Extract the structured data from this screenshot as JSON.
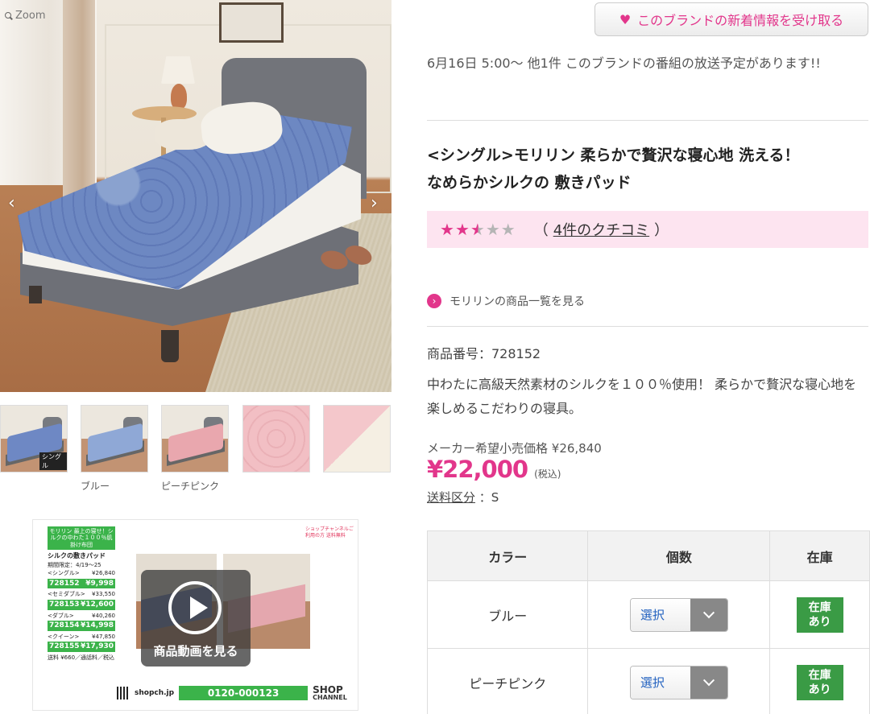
{
  "gallery": {
    "zoom_label": "Zoom",
    "prev_icon": "chevron-left-icon",
    "next_icon": "chevron-right-icon",
    "thumb_single_label": "シングル",
    "thumb_captions": [
      "ブルー",
      "ピーチピンク"
    ]
  },
  "video": {
    "banner": "モリリン 最上の寝せ！シルクの中わた１００％肌掛け布団",
    "product_name": "シルクの敷きパッド",
    "period": "期間限定：4/19〜25",
    "items": [
      {
        "size": "<シングル>",
        "msrp": "¥26,840",
        "code": "728152",
        "price": "¥9,998"
      },
      {
        "size": "<セミダブル>",
        "msrp": "¥33,550",
        "code": "728153",
        "price": "¥12,600"
      },
      {
        "size": "<ダブル>",
        "msrp": "¥40,260",
        "code": "728154",
        "price": "¥14,998"
      },
      {
        "size": "<クイーン>",
        "msrp": "¥47,850",
        "code": "728155",
        "price": "¥17,930"
      }
    ],
    "note": "送料 ¥660／通話料／税込",
    "top_right": "ショップチャンネルご利用の方 送料無料",
    "site": "shopch.jp",
    "phone": "0120-000123",
    "logo_line1": "SHOP",
    "logo_line2": "CHANNEL",
    "play_label": "商品動画を見る"
  },
  "follow": {
    "label": "このブランドの新着情報を受け取る",
    "icon": "heart-icon"
  },
  "broadcast": "6月16日 5:00〜 他1件 このブランドの番組の放送予定があります!!",
  "product": {
    "title_line1": "<シングル>モリリン 柔らかで贅沢な寝心地 洗える！",
    "title_line2": "なめらかシルクの 敷きパッド",
    "rating": 2.5,
    "rating_max": 5,
    "review_open": "（",
    "review_link": "4件のクチコミ",
    "review_close": "）",
    "brand_link": "モリリンの商品一覧を見る",
    "product_number": "商品番号：728152",
    "description": "中わたに高級天然素材のシルクを１００％使用！ 柔らかで贅沢な寝心地を楽しめるこだわりの寝具。",
    "msrp": "メーカー希望小売価格 ¥26,840",
    "price": "¥22,000",
    "tax_note": "(税込)",
    "shipping_label": "送料区分",
    "shipping_value": "：S"
  },
  "stock_table": {
    "headers": [
      "カラー",
      "個数",
      "在庫"
    ],
    "rows": [
      {
        "color": "ブルー",
        "qty": "選択",
        "stock": "在庫あり"
      },
      {
        "color": "ピーチピンク",
        "qty": "選択",
        "stock": "在庫あり"
      }
    ]
  },
  "colors": {
    "accent": "#e2368b",
    "review_bg": "#fde4f0",
    "stock_green": "#3a9b45",
    "video_green": "#3bb34a"
  }
}
